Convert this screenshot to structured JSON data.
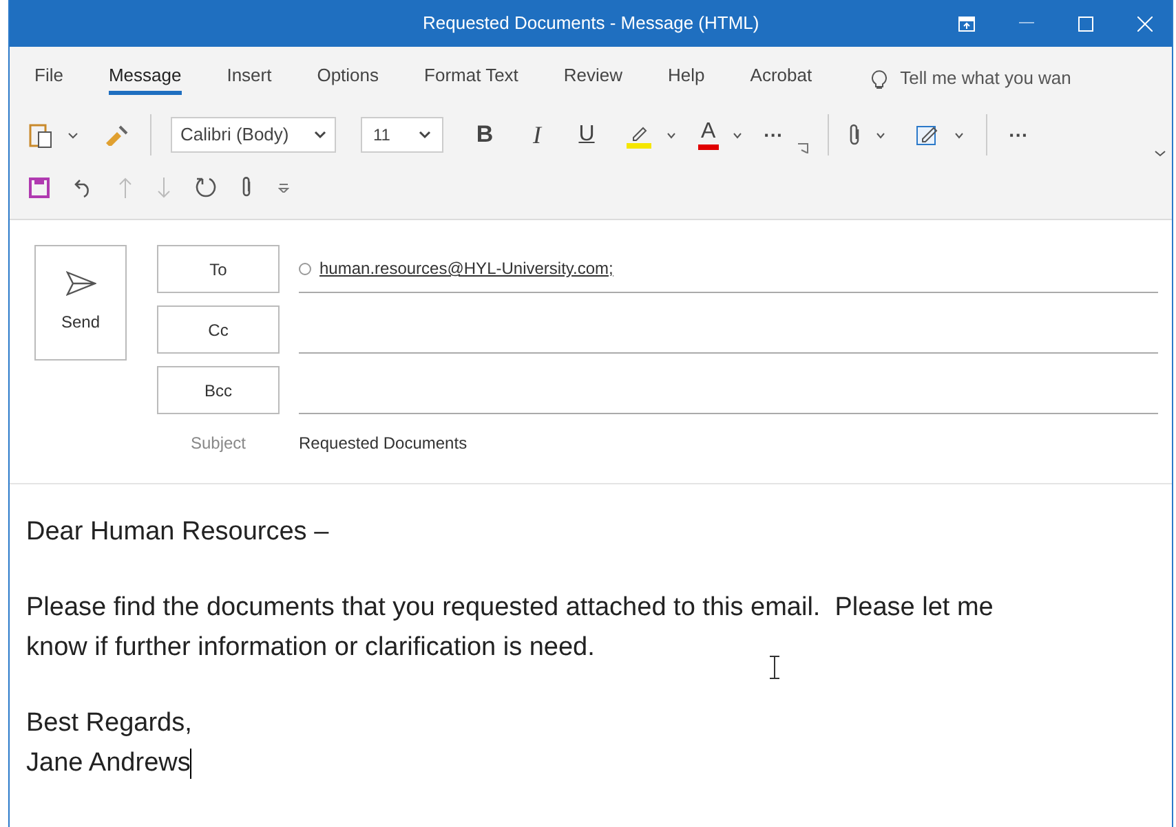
{
  "window": {
    "title": "Requested Documents  -  Message (HTML)"
  },
  "tabs": [
    {
      "label": "File",
      "selected": false
    },
    {
      "label": "Message",
      "selected": true
    },
    {
      "label": "Insert",
      "selected": false
    },
    {
      "label": "Options",
      "selected": false
    },
    {
      "label": "Format Text",
      "selected": false
    },
    {
      "label": "Review",
      "selected": false
    },
    {
      "label": "Help",
      "selected": false
    },
    {
      "label": "Acrobat",
      "selected": false
    }
  ],
  "search": {
    "placeholder": "Tell me what you wan"
  },
  "ribbon": {
    "font": "Calibri (Body)",
    "size": "11",
    "bold": "B",
    "italic": "I",
    "underline": "U",
    "font_color": "A",
    "more": "···",
    "more_right": "···"
  },
  "header": {
    "send": "Send",
    "fields": [
      {
        "button": "To",
        "value": "human.resources@HYL-University.com;"
      },
      {
        "button": "Cc"
      },
      {
        "button": "Bcc"
      }
    ],
    "subject_label": "Subject",
    "subject": "Requested Documents"
  },
  "body": [
    {
      "lines": [
        "Dear Human Resources –"
      ]
    },
    {
      "lines": [
        "Please find the documents that you requested attached to this email.  Please let me know if further information or clarification is need."
      ]
    },
    {
      "lines": [
        "Best Regards,",
        "Jane Andrews"
      ]
    }
  ]
}
